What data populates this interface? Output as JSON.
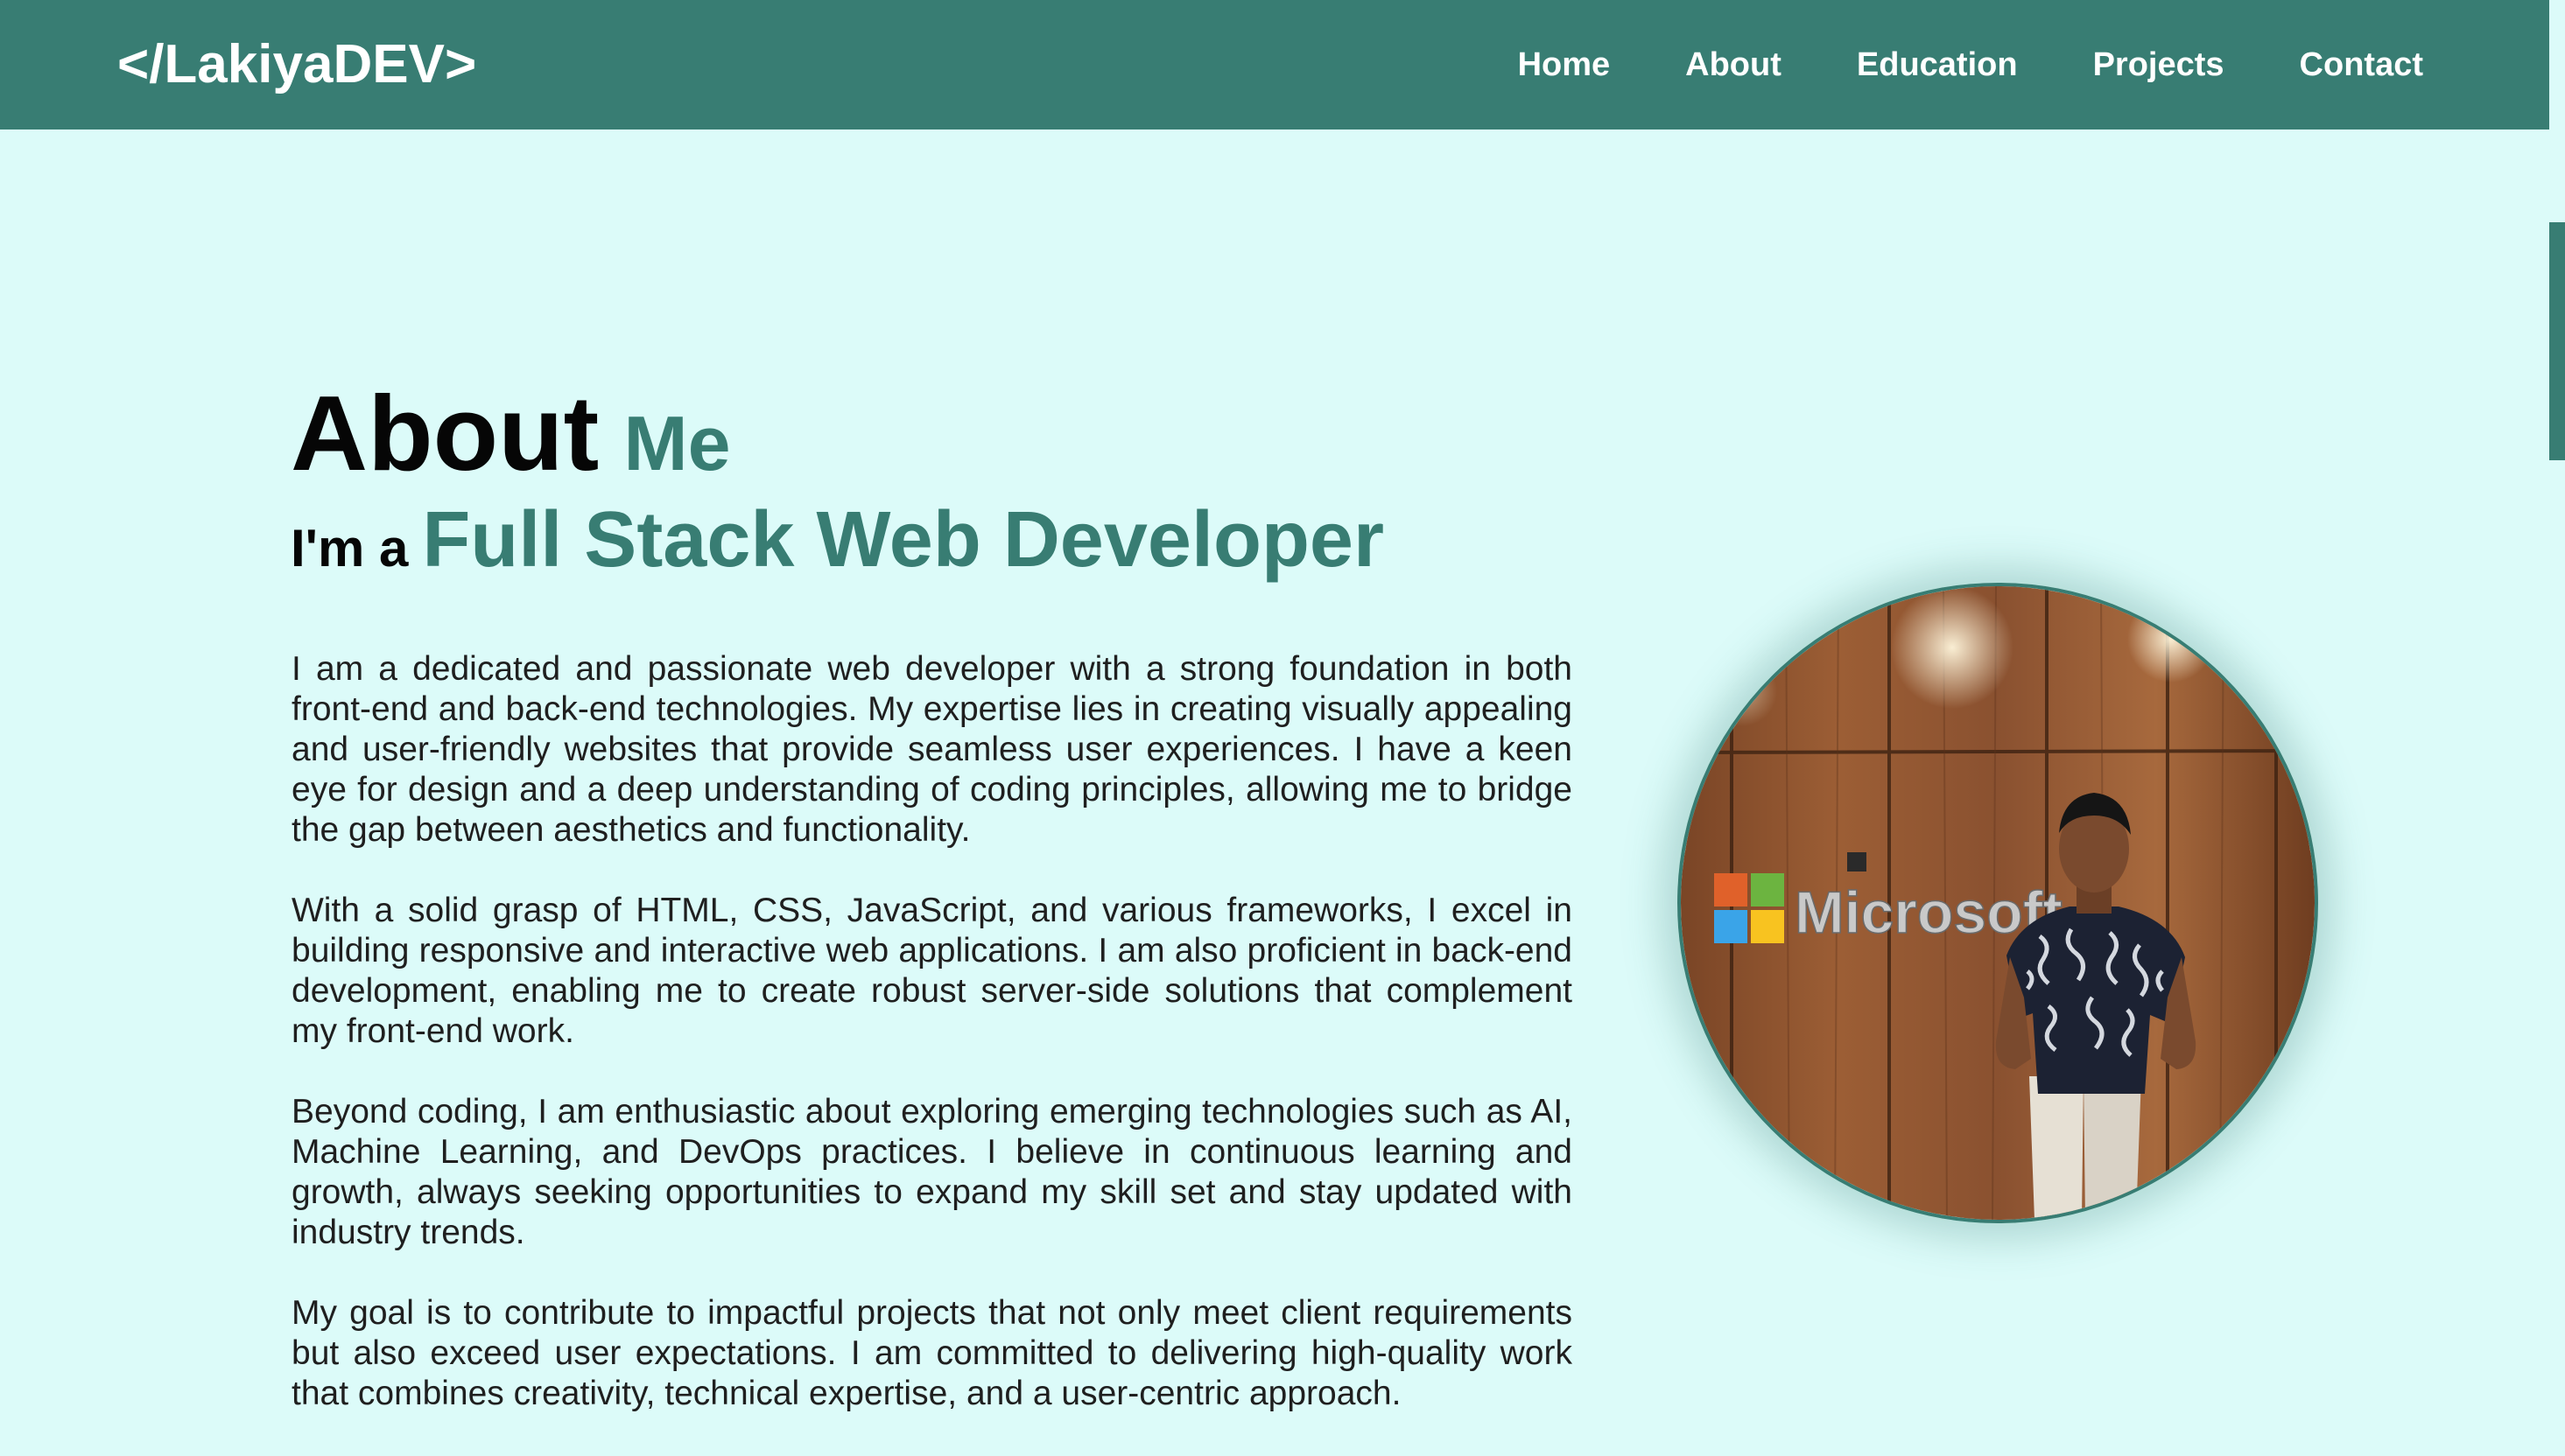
{
  "navbar": {
    "logo": "</LakiyaDEV>",
    "links": [
      "Home",
      "About",
      "Education",
      "Projects",
      "Contact"
    ]
  },
  "about": {
    "heading": "About",
    "heading_accent": "Me",
    "intro": "I'm a",
    "role": "Full Stack Web Developer",
    "paragraphs": [
      "I am a dedicated and passionate web developer with a strong foundation in both front-end and back-end technologies. My expertise lies in creating visually appealing and user-friendly websites that provide seamless user experiences. I have a keen eye for design and a deep understanding of coding principles, allowing me to bridge the gap between aesthetics and functionality.",
      "With a solid grasp of HTML, CSS, JavaScript, and various frameworks, I excel in building responsive and interactive web applications. I am also proficient in back-end development, enabling me to create robust server-side solutions that complement my front-end work.",
      "Beyond coding, I am enthusiastic about exploring emerging technologies such as AI, Machine Learning, and DevOps practices. I believe in continuous learning and growth, always seeking opportunities to expand my skill set and stay updated with industry trends.",
      "My goal is to contribute to impactful projects that not only meet client requirements but also exceed user expectations. I am committed to delivering high-quality work that combines creativity, technical expertise, and a user-centric approach."
    ]
  },
  "photo": {
    "wall_text": "Microsoft"
  },
  "colors": {
    "primary": "#387d73",
    "background": "#dcfbf9",
    "text": "#1f1f1f"
  }
}
